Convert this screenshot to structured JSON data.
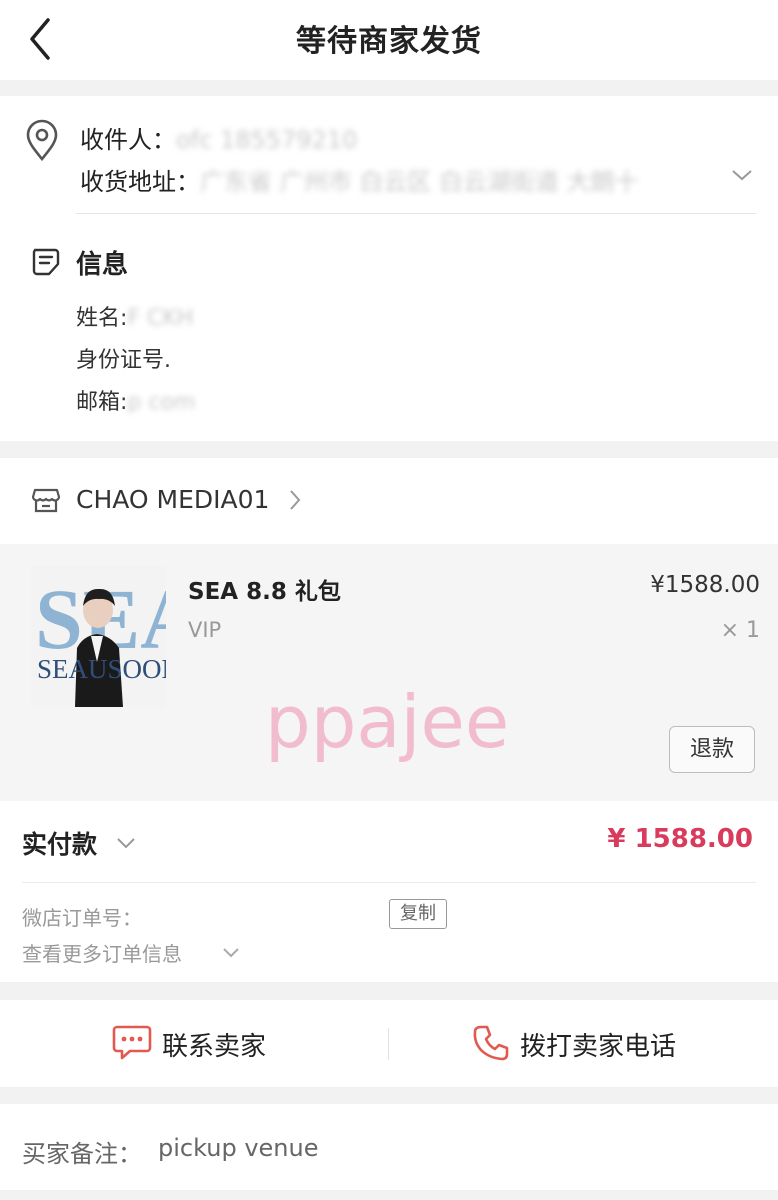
{
  "header": {
    "title": "等待商家发货"
  },
  "address": {
    "recipient_label": "收件人：",
    "recipient_value": "ofc  185579210",
    "address_label": "收货地址：",
    "address_value": "广东省 广州市 白云区 白云湖街道 大朗十"
  },
  "info": {
    "title": "信息",
    "rows": [
      {
        "label": "姓名:",
        "value": "F          CKH"
      },
      {
        "label": "身份证号.",
        "value": ""
      },
      {
        "label": "邮箱:",
        "value": "p             com"
      }
    ]
  },
  "shop": {
    "name": "CHAO MEDIA01"
  },
  "item": {
    "name": "SEA 8.8 礼包",
    "sku": "VIP",
    "price": "¥1588.00",
    "qty": "× 1",
    "refund_label": "退款",
    "image_title": "SEA",
    "image_subtitle": "SEAUSOON."
  },
  "watermark": "ppajee",
  "payment": {
    "label": "实付款",
    "total": "¥ 1588.00",
    "order_no_label": "微店订单号：",
    "copy_label": "复制",
    "more_label": "查看更多订单信息"
  },
  "contact": {
    "chat_label": "联系卖家",
    "call_label": "拨打卖家电话"
  },
  "note": {
    "label": "买家备注：",
    "value": "pickup venue"
  },
  "colors": {
    "accent": "#d83b5c",
    "icon_red": "#e25a4f",
    "watermark": "#f1b6c9"
  }
}
